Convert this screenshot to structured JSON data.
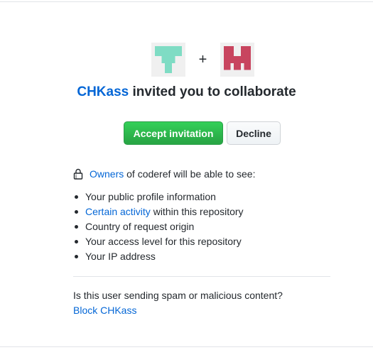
{
  "invite": {
    "inviter": "CHKass",
    "title_rest": " invited you to collaborate",
    "plus": "+"
  },
  "actions": {
    "accept_label": "Accept invitation",
    "decline_label": "Decline"
  },
  "permissions": {
    "owners_link": "Owners",
    "head_rest": " of coderef will be able to see:",
    "items": [
      {
        "text": "Your public profile information"
      },
      {
        "link": "Certain activity",
        "text": " within this repository"
      },
      {
        "text": "Country of request origin"
      },
      {
        "text": "Your access level for this repository"
      },
      {
        "text": "Your IP address"
      }
    ]
  },
  "report": {
    "question": "Is this user sending spam or malicious content?",
    "block_label": "Block CHKass"
  },
  "colors": {
    "link": "#0366d6",
    "accept_bg": "#28a745",
    "inviter_avatar": "#7fdcc4",
    "repo_avatar": "#c8455f"
  },
  "icons": {
    "inviter_avatar": "identicon-teal",
    "repo_avatar": "identicon-red",
    "lock": "lock-icon"
  }
}
